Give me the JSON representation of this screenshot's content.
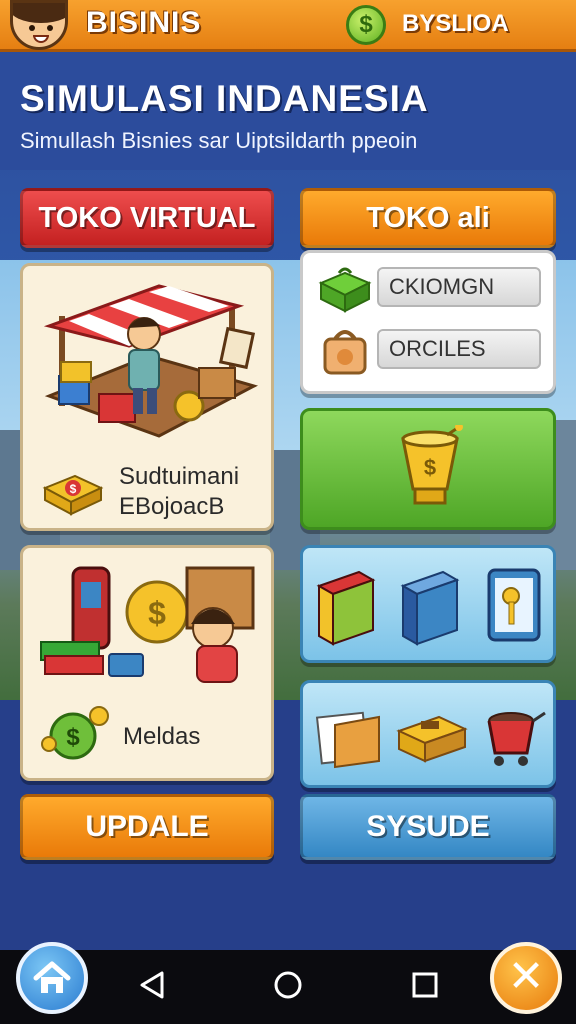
{
  "header": {
    "app_name": "BISINIS",
    "currency_label": "BYSLIOA",
    "coin_symbol": "$"
  },
  "title": {
    "main": "SIMULASI INDANESIA",
    "subtitle": "Simullash Bisnies sar Uiptsildarth ppeoin"
  },
  "left_column": {
    "toko_virtual_button": "TOKO VIRTUAL",
    "shop_card": {
      "caption_line1": "Sudtuimani",
      "caption_line2": "EBojoacB"
    },
    "items_card": {
      "caption": "Meldas"
    },
    "update_button": "UPDALE"
  },
  "right_column": {
    "toko_ali_button": "TOKO ali",
    "options": [
      "CKIOMGN",
      "ORCILES"
    ],
    "sysude_button": "SYSUDE"
  },
  "colors": {
    "accent_orange": "#f29523",
    "accent_red": "#d93636",
    "accent_green": "#5cb530",
    "accent_blue": "#4a9bd4",
    "title_band": "#2c4c9c"
  },
  "nav": {
    "close_symbol": "✕"
  }
}
